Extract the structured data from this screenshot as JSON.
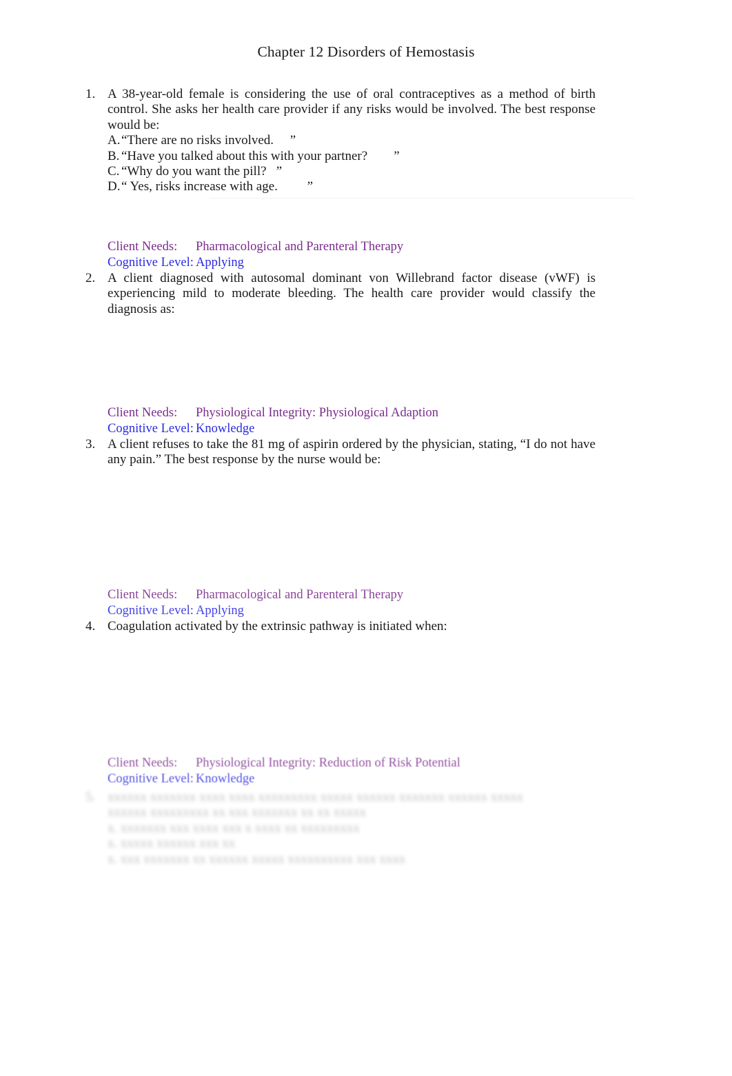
{
  "document": {
    "title": "Chapter 12 Disorders of Hemostasis"
  },
  "colors": {
    "client_needs": "#7a2b8c",
    "cognitive_level": "#2a2ae0",
    "body_text": "#1a1a1a",
    "page_background": "#ffffff"
  },
  "meta_labels": {
    "client_needs": "Client Needs:",
    "cognitive_level": "Cognitive Level:"
  },
  "questions": [
    {
      "number": "1.",
      "stem": "A 38-year-old female is considering the use of oral contraceptives as a method of birth control. She asks her health care provider if any risks would be involved. The best response would be:",
      "options": [
        {
          "letter": "A.",
          "text": "“There are no risks involved.     ”"
        },
        {
          "letter": "B.",
          "text": "“Have you talked about this with your partner?        ”"
        },
        {
          "letter": "C.",
          "text": "“Why do you want the pill?   ”"
        },
        {
          "letter": "D.",
          "text": "“ Yes, risks increase with age.         ”"
        }
      ],
      "client_needs": "Pharmacological and Parenteral Therapy",
      "cognitive_level": "Applying"
    },
    {
      "number": "2.",
      "stem": "A client diagnosed with autosomal dominant von Willebrand factor disease (vWF) is experiencing mild to moderate bleeding. The health care provider would classify the diagnosis as:",
      "options": [],
      "client_needs": "Physiological Integrity: Physiological Adaption",
      "cognitive_level": "Knowledge"
    },
    {
      "number": "3.",
      "stem": "A client refuses to take the 81 mg of aspirin ordered by the physician, stating, “I do not have any pain.” The best response by the nurse would be:",
      "options": [],
      "client_needs": "Pharmacological and Parenteral Therapy",
      "cognitive_level": "Applying"
    },
    {
      "number": "4.",
      "stem": "Coagulation activated by the extrinsic pathway is initiated when:",
      "options": [],
      "client_needs": "Physiological Integrity: Reduction of Risk Potential",
      "cognitive_level": "Knowledge"
    }
  ],
  "obscured_question": {
    "number": "5.",
    "note": "illegible",
    "stem_line_1": "xxxxxx xxxxxxx xxxx xxxx xxxxxxxxx xxxxx xxxxxx xxxxxxx xxxxxx xxxxx",
    "stem_line_2": "xxxxxx xxxxxxxxx xx xxx xxxxxxx xx xx xxxxx",
    "option_lines": [
      "x.  xxxxxxx xxx xxxx xxx x xxxx xx xxxxxxxxx",
      "x.  xxxxx  xxxxxx  xxx xx",
      "x.  xxx xxxxxxx xx xxxxxx xxxxx xxxxxxxxxx xxx xxxx"
    ]
  }
}
